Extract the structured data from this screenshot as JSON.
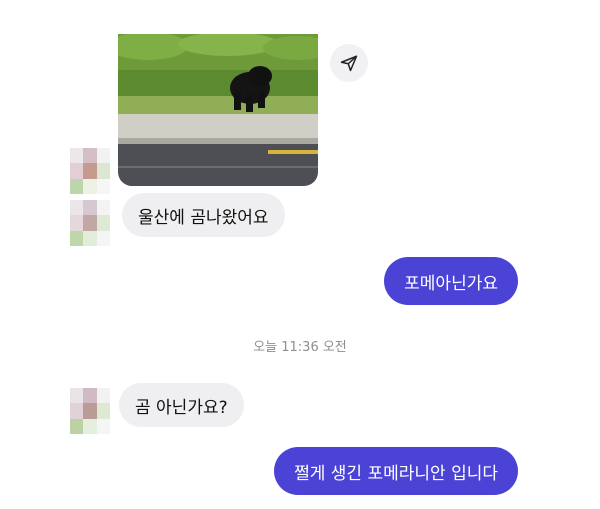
{
  "conversation": {
    "messages": [
      {
        "sender": "other",
        "type": "image",
        "alt": ""
      },
      {
        "sender": "other",
        "type": "text",
        "text": "울산에 곰나왔어요"
      },
      {
        "sender": "me",
        "type": "text",
        "text": "포메아닌가요"
      },
      {
        "sender": "other",
        "type": "text",
        "text": "곰 아닌가요?"
      },
      {
        "sender": "me",
        "type": "text",
        "text": "쩔게 생긴 포메라니안 입니다"
      }
    ],
    "timestamp": "오늘 11:36 오전"
  },
  "icons": {
    "share": "send-plane-icon"
  },
  "colors": {
    "outgoing_bubble": "#4b43d6",
    "incoming_bubble": "#efeff1",
    "timestamp_text": "#8e8e93"
  }
}
